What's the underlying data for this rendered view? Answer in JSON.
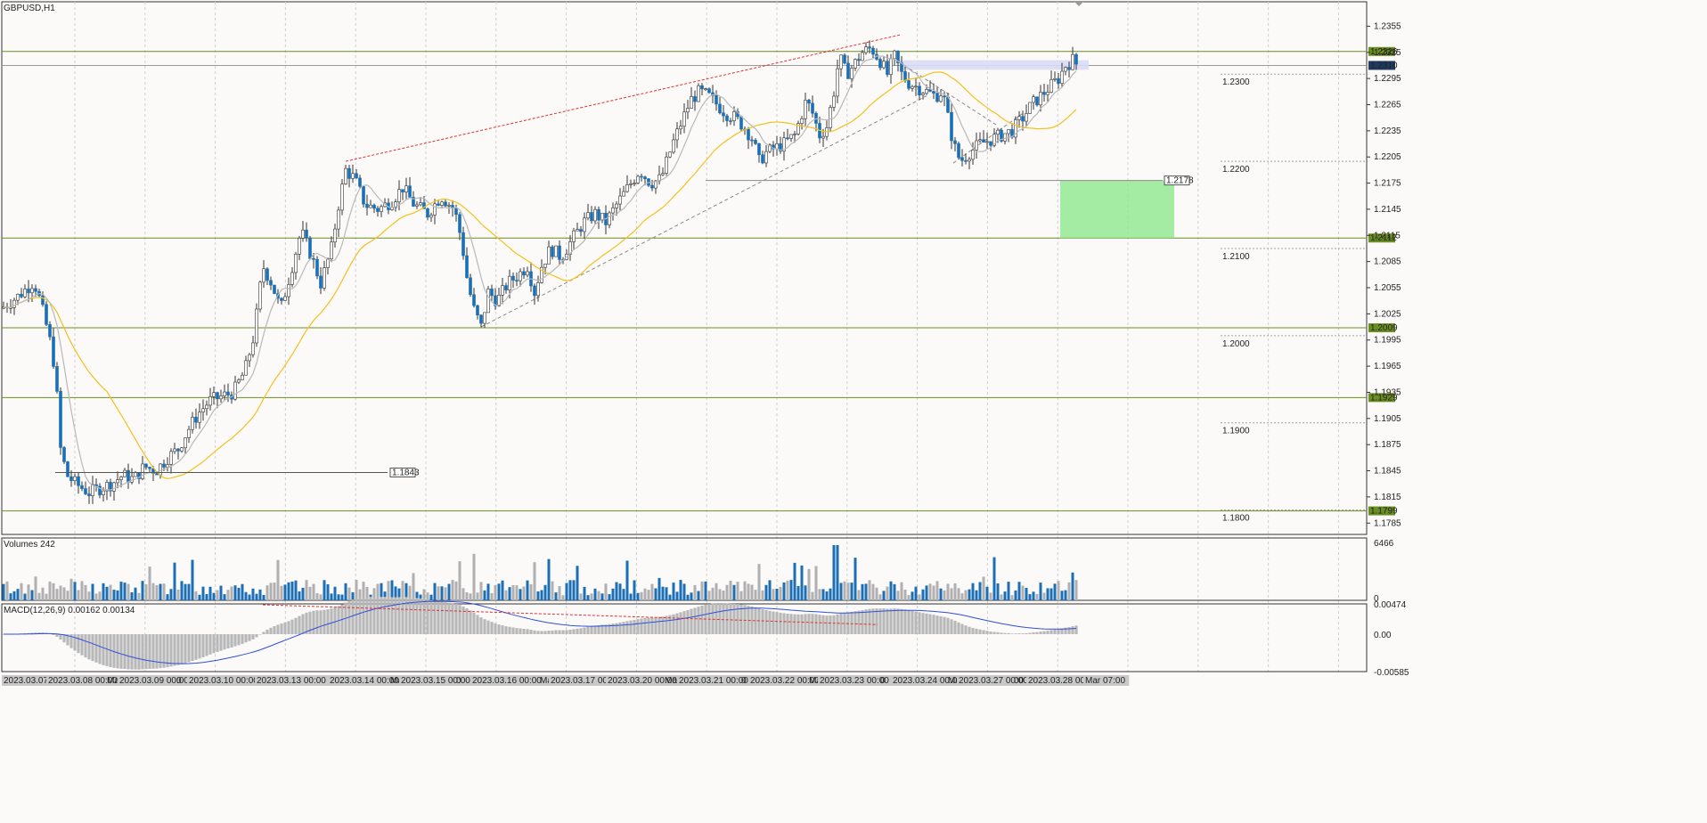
{
  "chart_data": {
    "type": "candlestick",
    "title": "GBPUSD,H1",
    "symbol": "GBPUSD",
    "timeframe": "H1",
    "price_axis": {
      "ylim": [
        1.1772,
        1.2383
      ],
      "ticks": [
        "1.2355",
        "1.2325",
        "1.2295",
        "1.2265",
        "1.2235",
        "1.2205",
        "1.2175",
        "1.2145",
        "1.2115",
        "1.2085",
        "1.2055",
        "1.2025",
        "1.1995",
        "1.1965",
        "1.1935",
        "1.1905",
        "1.1875",
        "1.1845",
        "1.1815",
        "1.1785"
      ]
    },
    "current_price": "1.2310",
    "horizontal_levels": [
      {
        "label": "1.2326",
        "value": 1.2326
      },
      {
        "label": "1.2112",
        "value": 1.2112
      },
      {
        "label": "1.2009",
        "value": 1.2009
      },
      {
        "label": "1.1929",
        "value": 1.1929
      },
      {
        "label": "1.1799",
        "value": 1.1799
      }
    ],
    "round_levels": [
      {
        "label": "1.2300",
        "value": 1.23
      },
      {
        "label": "1.2200",
        "value": 1.22
      },
      {
        "label": "1.2100",
        "value": 1.21
      },
      {
        "label": "1.2000",
        "value": 1.2
      },
      {
        "label": "1.1900",
        "value": 1.19
      },
      {
        "label": "1.1800",
        "value": 1.18
      }
    ],
    "annotations": [
      {
        "label": "1.2178",
        "value": 1.2178
      },
      {
        "label": "1.1843",
        "value": 1.1843
      }
    ],
    "target_zone": {
      "top": 1.2178,
      "bottom": 1.2112
    },
    "time_labels": [
      "2023.03.07 00:00",
      "2023.03.08 00:00",
      "Mar",
      "2023.03.09 00:00",
      "0",
      "2023.03.10 00:00",
      "2023.03.13 00:00",
      "2023.03.14 00:00",
      "Mar",
      "2023.03.15 00:00",
      "0",
      "2023.03.16 00:00",
      "Mar",
      "2023.03.17 00:00",
      "2023.03.20 00:00",
      "Mar",
      "2023.03.21 00:00",
      "0",
      "2023.03.22 00:00",
      "Mar",
      "2023.03.23 00:00",
      "0",
      "2023.03.24 00:00",
      "Mar",
      "2023.03.27 00:00",
      "00",
      "2023.03.28 00:00",
      "Mar 07:00"
    ],
    "price_path": [
      [
        0,
        1.203
      ],
      [
        20,
        1.2045
      ],
      [
        38,
        1.2062
      ],
      [
        45,
        1.204
      ],
      [
        55,
        1.2
      ],
      [
        62,
        1.196
      ],
      [
        68,
        1.187
      ],
      [
        75,
        1.184
      ],
      [
        85,
        1.183
      ],
      [
        100,
        1.182
      ],
      [
        112,
        1.1825
      ],
      [
        125,
        1.183
      ],
      [
        138,
        1.184
      ],
      [
        150,
        1.1835
      ],
      [
        162,
        1.185
      ],
      [
        175,
        1.1845
      ],
      [
        188,
        1.186
      ],
      [
        200,
        1.187
      ],
      [
        210,
        1.189
      ],
      [
        222,
        1.191
      ],
      [
        235,
        1.1925
      ],
      [
        248,
        1.193
      ],
      [
        262,
        1.1935
      ],
      [
        275,
        1.196
      ],
      [
        285,
        1.2
      ],
      [
        295,
        1.208
      ],
      [
        305,
        1.206
      ],
      [
        315,
        1.203
      ],
      [
        328,
        1.208
      ],
      [
        338,
        1.212
      ],
      [
        350,
        1.209
      ],
      [
        360,
        1.206
      ],
      [
        372,
        1.21
      ],
      [
        380,
        1.215
      ],
      [
        388,
        1.219
      ],
      [
        398,
        1.218
      ],
      [
        410,
        1.215
      ],
      [
        425,
        1.2145
      ],
      [
        440,
        1.2155
      ],
      [
        452,
        1.217
      ],
      [
        465,
        1.215
      ],
      [
        480,
        1.214
      ],
      [
        495,
        1.216
      ],
      [
        510,
        1.2145
      ],
      [
        518,
        1.211
      ],
      [
        525,
        1.206
      ],
      [
        532,
        1.203
      ],
      [
        540,
        1.201
      ],
      [
        548,
        1.205
      ],
      [
        558,
        1.204
      ],
      [
        570,
        1.206
      ],
      [
        582,
        1.207
      ],
      [
        592,
        1.208
      ],
      [
        600,
        1.205
      ],
      [
        608,
        1.208
      ],
      [
        618,
        1.21
      ],
      [
        630,
        1.209
      ],
      [
        642,
        1.211
      ],
      [
        655,
        1.213
      ],
      [
        668,
        1.214
      ],
      [
        680,
        1.213
      ],
      [
        692,
        1.215
      ],
      [
        705,
        1.217
      ],
      [
        718,
        1.219
      ],
      [
        730,
        1.2175
      ],
      [
        742,
        1.218
      ],
      [
        755,
        1.222
      ],
      [
        765,
        1.2245
      ],
      [
        775,
        1.227
      ],
      [
        785,
        1.228
      ],
      [
        795,
        1.2275
      ],
      [
        805,
        1.2265
      ],
      [
        815,
        1.2255
      ],
      [
        825,
        1.225
      ],
      [
        835,
        1.224
      ],
      [
        845,
        1.2225
      ],
      [
        852,
        1.22
      ],
      [
        860,
        1.221
      ],
      [
        870,
        1.2215
      ],
      [
        880,
        1.222
      ],
      [
        892,
        1.223
      ],
      [
        905,
        1.227
      ],
      [
        912,
        1.2255
      ],
      [
        920,
        1.223
      ],
      [
        928,
        1.224
      ],
      [
        936,
        1.228
      ],
      [
        942,
        1.232
      ],
      [
        950,
        1.23
      ],
      [
        958,
        1.231
      ],
      [
        968,
        1.2325
      ],
      [
        978,
        1.233
      ],
      [
        988,
        1.2315
      ],
      [
        996,
        1.23
      ],
      [
        1004,
        1.232
      ],
      [
        1012,
        1.23
      ],
      [
        1020,
        1.229
      ],
      [
        1030,
        1.2285
      ],
      [
        1040,
        1.228
      ],
      [
        1050,
        1.2275
      ],
      [
        1058,
        1.228
      ],
      [
        1064,
        1.225
      ],
      [
        1070,
        1.222
      ],
      [
        1078,
        1.22
      ],
      [
        1088,
        1.221
      ],
      [
        1100,
        1.222
      ],
      [
        1112,
        1.2225
      ],
      [
        1124,
        1.223
      ],
      [
        1136,
        1.2235
      ],
      [
        1148,
        1.225
      ],
      [
        1158,
        1.2265
      ],
      [
        1168,
        1.2275
      ],
      [
        1178,
        1.2285
      ],
      [
        1188,
        1.2295
      ],
      [
        1196,
        1.231
      ],
      [
        1204,
        1.2316
      ],
      [
        1208,
        1.2312
      ]
    ],
    "moving_averages": [
      {
        "color": "#f2c21b",
        "period_bars": 30
      },
      {
        "color": "#b8b8b8",
        "period_bars": 8
      }
    ],
    "volume_panel": {
      "label": "Volumes 242",
      "ylim": [
        0,
        6466
      ],
      "ticks": [
        "6466",
        "0"
      ]
    },
    "macd_panel": {
      "label": "MACD(12,26,9) 0.00162 0.00134",
      "ylim": [
        -0.00585,
        0.00474
      ],
      "ticks": [
        "0.00474",
        "0.00",
        "-0.00585"
      ]
    },
    "colors": {
      "bull": "#1a6fb5",
      "bear": "#1a6fb5",
      "wick": "#333333",
      "level": "#6b8e23",
      "current": "#1f3a5f",
      "zone": "#8de88d",
      "resistance_zone": "#d8dcf5",
      "trendline_red": "#e03030",
      "trendline_gray": "#888888",
      "volume_up": "#1a6fb5",
      "volume_down": "#b0b0b0",
      "macd_hist": "#b8b8b8",
      "macd_signal": "#2f4fd8"
    }
  }
}
